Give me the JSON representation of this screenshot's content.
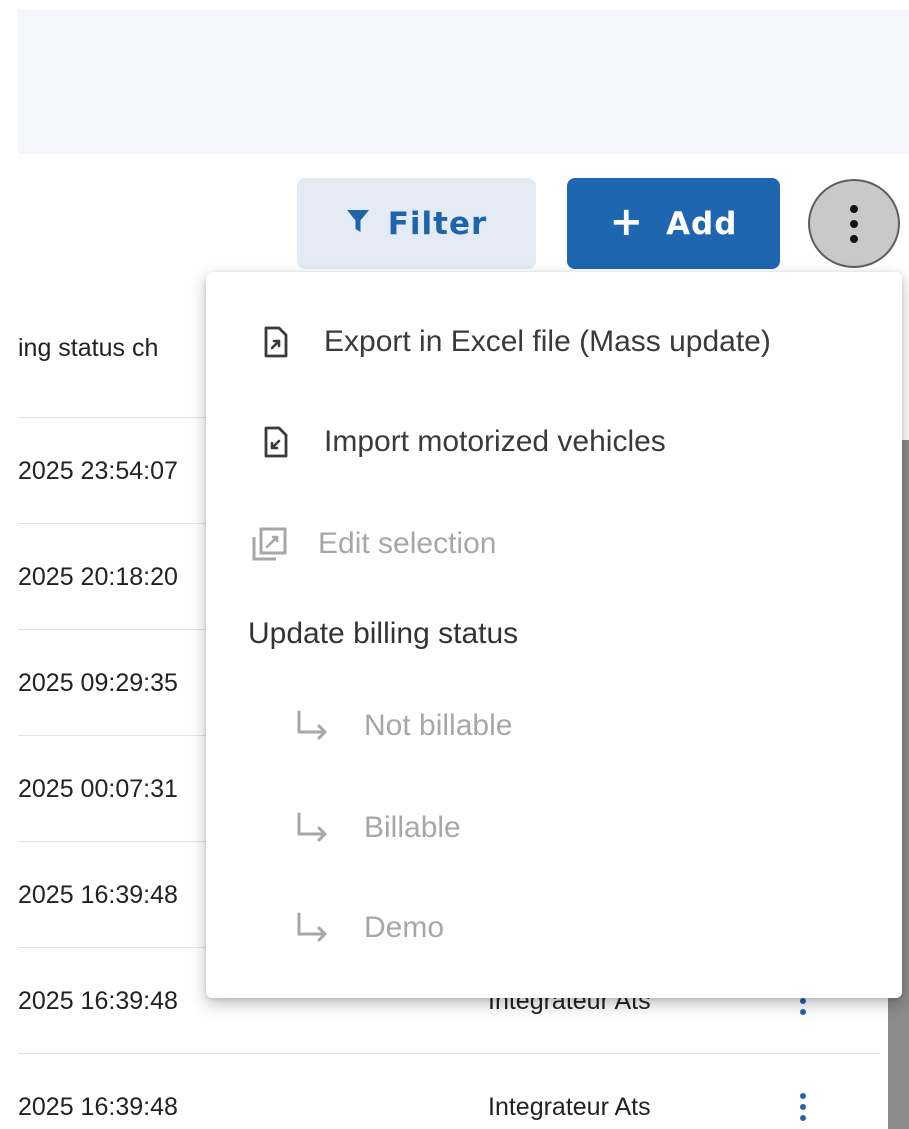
{
  "toolbar": {
    "filter_label": "Filter",
    "add_label": "Add",
    "add_symbol": "+",
    "accent_color": "#1e66b0",
    "filter_icon": "funnel-icon",
    "more_icon": "vertical-dots-icon"
  },
  "table": {
    "header": "ing status ch",
    "rows": [
      {
        "date": "2025 23:54:07",
        "user": ""
      },
      {
        "date": "2025 20:18:20",
        "user": ""
      },
      {
        "date": "2025 09:29:35",
        "user": ""
      },
      {
        "date": "2025 00:07:31",
        "user": ""
      },
      {
        "date": "2025 16:39:48",
        "user": ""
      },
      {
        "date": "2025 16:39:48",
        "user": "Integrateur Ats"
      },
      {
        "date": "2025 16:39:48",
        "user": "Integrateur Ats"
      }
    ]
  },
  "menu": {
    "export_label": "Export in Excel file (Mass update)",
    "import_label": "Import motorized vehicles",
    "edit_label": "Edit selection",
    "billing_header": "Update billing status",
    "not_billable_label": "Not billable",
    "billable_label": "Billable",
    "demo_label": "Demo",
    "export_icon": "file-export-icon",
    "import_icon": "file-import-icon",
    "edit_icon": "edit-selection-icon",
    "sub_icon": "subdirectory-arrow-icon"
  }
}
